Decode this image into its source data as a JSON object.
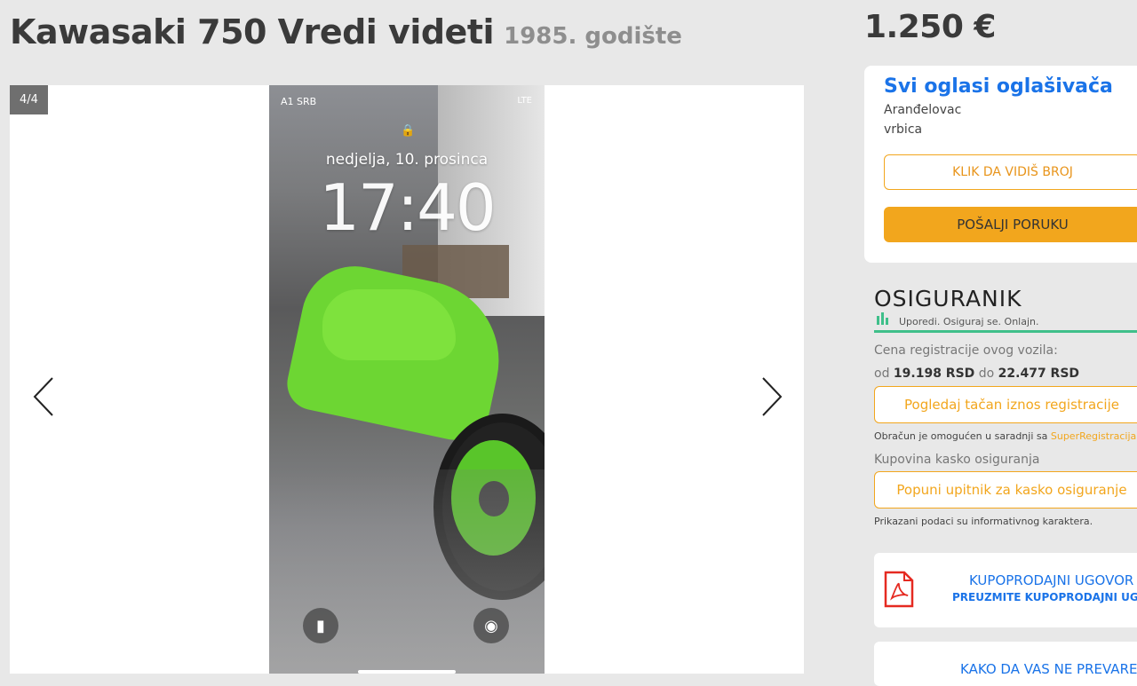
{
  "listing": {
    "title": "Kawasaki 750 Vredi videti",
    "year": "1985. godište",
    "price": "1.250 €"
  },
  "gallery": {
    "counter": "4/4",
    "prev_icon": "chevron-left-icon",
    "next_icon": "chevron-right-icon",
    "photo": {
      "carrier": "A1 SRB",
      "status": "LTE",
      "date": "nedjelja, 10. prosinca",
      "time": "17:40"
    }
  },
  "seller": {
    "all_ads": "Svi oglasi oglašivača",
    "city": "Aranđelovac",
    "area": "vrbica",
    "show_number": "KLIK DA VIDIŠ BROJ",
    "send_message": "POŠALJI PORUKU"
  },
  "insurance": {
    "brand": "OSIGURANIK",
    "slogan": "Uporedi. Osiguraj se. Onlajn.",
    "reg_label": "Cena registracije ovog vozila:",
    "from_word": "od",
    "from_value": "19.198 RSD",
    "to_word": "do",
    "to_value": "22.477 RSD",
    "reg_button": "Pogledaj tačan iznos registracije",
    "partner_text": "Obračun je omogućen u saradnji sa",
    "partner_name": "SuperRegistracija",
    "kasko_label": "Kupovina kasko osiguranja",
    "kasko_button": "Popuni upitnik za kasko osiguranje",
    "disclaimer": "Prikazani podaci su informativnog karaktera."
  },
  "contract": {
    "title": "KUPOPRODAJNI UGOVOR",
    "subtitle": "PREUZMITE KUPOPRODAJNI UGOV"
  },
  "warning": {
    "title": "KAKO DA VAS NE PREVARE"
  },
  "colors": {
    "accent": "#f2a61d",
    "link": "#1a73e8",
    "insurance_green": "#3fbf8a"
  }
}
